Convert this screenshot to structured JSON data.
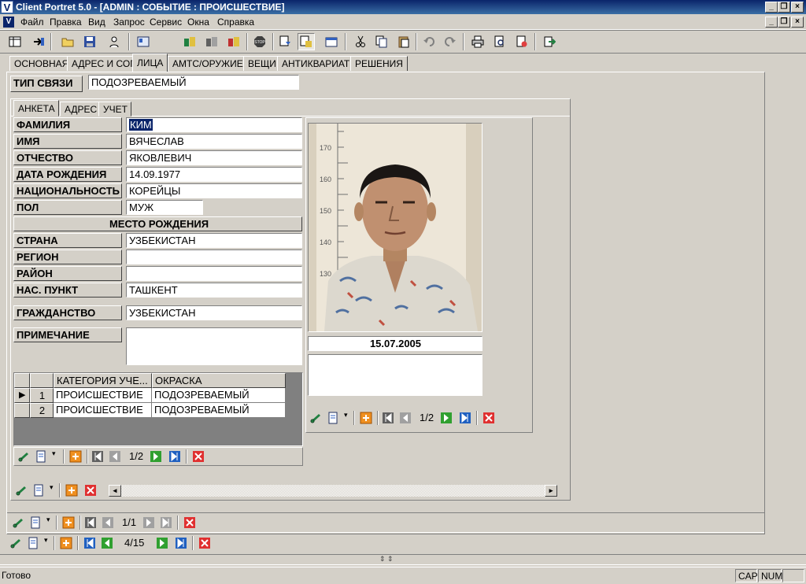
{
  "window": {
    "title": "Client Portret 5.0 - [ADMIN : СОБЫТИЕ : ПРОИСШЕСТВИЕ]",
    "app_icon_letter": "V"
  },
  "menu": [
    "Файл",
    "Правка",
    "Вид",
    "Запрос",
    "Сервис",
    "Окна",
    "Справка"
  ],
  "toolbar_icons": [
    "grid-view-icon",
    "navigate-icon",
    "open-folder-icon",
    "save-icon",
    "person-search-icon",
    "card-icon",
    "query-1-icon",
    "query-2-icon",
    "query-3-icon",
    "stop-icon",
    "filter-icon",
    "filter-pressed-icon",
    "window-icon",
    "cut-icon",
    "copy-icon",
    "paste-icon",
    "undo-icon",
    "redo-icon",
    "print-icon",
    "preview-icon",
    "export-icon",
    "exit-icon"
  ],
  "main_tabs": [
    {
      "label": "ОСНОВНАЯ",
      "active": false
    },
    {
      "label": "АДРЕС И СОГ",
      "active": false
    },
    {
      "label": "ЛИЦА",
      "active": true
    },
    {
      "label": "АМТС/ОРУЖИЕ",
      "active": false
    },
    {
      "label": "ВЕЩИ",
      "active": false
    },
    {
      "label": "АНТИКВАРИАТ",
      "active": false
    },
    {
      "label": "РЕШЕНИЯ",
      "active": false
    }
  ],
  "link_type": {
    "label": "ТИП СВЯЗИ",
    "value": "ПОДОЗРЕВАЕМЫЙ"
  },
  "sub_tabs": [
    {
      "label": "АНКЕТА",
      "active": true
    },
    {
      "label": "АДРЕС",
      "active": false
    },
    {
      "label": "УЧЕТ",
      "active": false
    }
  ],
  "form": {
    "surname": {
      "label": "ФАМИЛИЯ",
      "value": "КИМ"
    },
    "name": {
      "label": "ИМЯ",
      "value": "ВЯЧЕСЛАВ"
    },
    "patronymic": {
      "label": "ОТЧЕСТВО",
      "value": "ЯКОВЛЕВИЧ"
    },
    "birth_date": {
      "label": "ДАТА РОЖДЕНИЯ",
      "value": "14.09.1977"
    },
    "nationality": {
      "label": "НАЦИОНАЛЬНОСТЬ",
      "value": "КОРЕЙЦЫ"
    },
    "sex": {
      "label": "ПОЛ",
      "value": "МУЖ"
    },
    "birthplace_header": "МЕСТО РОЖДЕНИЯ",
    "country": {
      "label": "СТРАНА",
      "value": "УЗБЕКИСТАН"
    },
    "region": {
      "label": "РЕГИОН",
      "value": ""
    },
    "district": {
      "label": "РАЙОН",
      "value": ""
    },
    "locality": {
      "label": "НАС. ПУНКТ",
      "value": "ТАШКЕНТ"
    },
    "citizenship": {
      "label": "ГРАЖДАНСТВО",
      "value": "УЗБЕКИСТАН"
    },
    "note": {
      "label": "ПРИМЕЧАНИЕ",
      "value": ""
    }
  },
  "record_grid": {
    "columns": [
      "",
      "",
      "КАТЕГОРИЯ УЧЕ...",
      "ОКРАСКА"
    ],
    "rows": [
      {
        "marker": "▶",
        "num": "1",
        "category": "ПРОИСШЕСТВИЕ",
        "color": "ПОДОЗРЕВАЕМЫЙ"
      },
      {
        "marker": "",
        "num": "2",
        "category": "ПРОИСШЕСТВИЕ",
        "color": "ПОДОЗРЕВАЕМЫЙ"
      }
    ]
  },
  "photo": {
    "ruler_marks": [
      "170",
      "160",
      "150",
      "140",
      "130"
    ],
    "date": "15.07.2005"
  },
  "navigators": {
    "grid": "1/2",
    "photo": "1/2",
    "lower": "1/1",
    "bottom": "4/15"
  },
  "status": {
    "text": "Готово",
    "cap": "CAP",
    "num": "NUM"
  },
  "colors": {
    "face": "#d4d0c8",
    "selection": "#0a246a",
    "title_start": "#0a246a",
    "title_end": "#3a6ea5"
  }
}
